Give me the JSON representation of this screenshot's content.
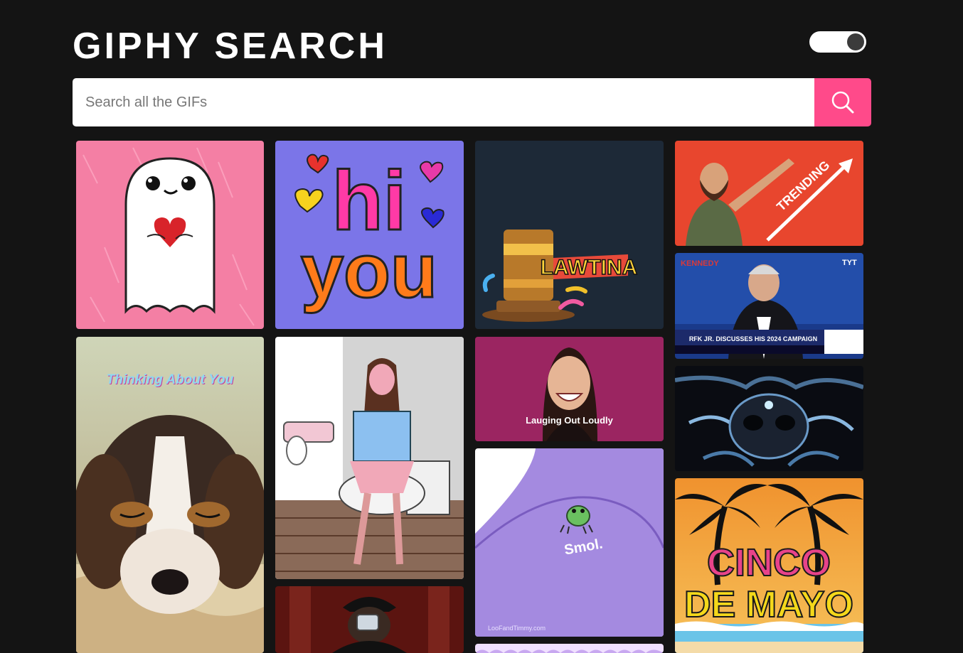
{
  "header": {
    "title": "GIPHY SEARCH"
  },
  "theme_toggle": {
    "state": "dark"
  },
  "search": {
    "placeholder": "Search all the GIFs",
    "value": ""
  },
  "gifs": [
    {
      "subject": "ghost holding heart"
    },
    {
      "subject": "hi you",
      "text_top": "hi",
      "text_bottom": "you"
    },
    {
      "subject": "gavel",
      "text": "LAWTINA"
    },
    {
      "subject": "man pointing up",
      "text": "TRENDING"
    },
    {
      "subject": "news broadcast",
      "channel": "TYT",
      "corner": "KENNEDY",
      "chyron": "RFK JR. DISCUSSES HIS 2024 CAMPAIGN"
    },
    {
      "subject": "metal skull"
    },
    {
      "subject": "beagle puppy",
      "caption": "Thinking About You"
    },
    {
      "subject": "girl on toilet"
    },
    {
      "subject": "woman laughing",
      "caption": "Lauging Out Loudly"
    },
    {
      "subject": "frog under blanket",
      "caption": "Smol.",
      "credit": "LooFandTimmy.com"
    },
    {
      "subject": "person drinking"
    },
    {
      "subject": "cinco de mayo",
      "line1": "CINCO",
      "line2": "DE MAYO"
    },
    {
      "subject": "partially visible gif"
    }
  ],
  "colors": {
    "background": "#141414",
    "accent": "#ff4a8a",
    "toggle_track": "#ffffff",
    "toggle_knob": "#3b3b3b"
  },
  "icons": {
    "search_button": "search-icon"
  }
}
